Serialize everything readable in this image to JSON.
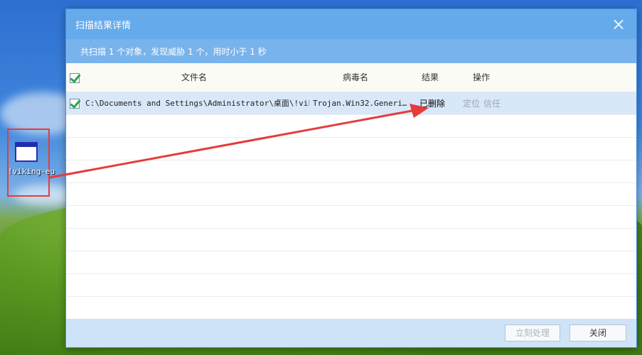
{
  "desktop": {
    "icon_label": "!viking-eu"
  },
  "dialog": {
    "title": "扫描结果详情",
    "summary": "共扫描 1 个对象，发现威胁 1 个，用时小于 1 秒",
    "columns": {
      "file": "文件名",
      "virus": "病毒名",
      "result": "结果",
      "action": "操作"
    },
    "rows": [
      {
        "file": "C:\\Documents and Settings\\Administrator\\桌面\\!viki…",
        "virus": "Trojan.Win32.Generi…",
        "result": "已删除",
        "locate": "定位",
        "trust": "信任"
      }
    ],
    "buttons": {
      "process_now": "立刻处理",
      "close": "关闭"
    }
  },
  "colors": {
    "titlebar": "#65aaea",
    "annotation": "#e63b3b",
    "selected_row": "#d8e8f9"
  }
}
